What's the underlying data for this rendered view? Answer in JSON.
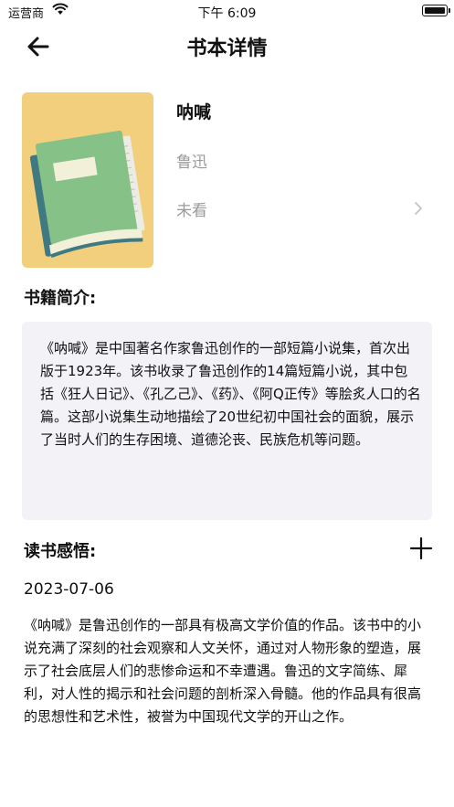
{
  "status_bar": {
    "carrier": "运营商",
    "time": "下午 6:09"
  },
  "nav": {
    "title": "书本详情",
    "back_icon": "arrow-left-icon"
  },
  "book": {
    "title": "呐喊",
    "author": "鲁迅",
    "read_status": "未看",
    "cover_icon": "book-icon"
  },
  "intro": {
    "heading": "书籍简介:",
    "text": "《呐喊》是中国著名作家鲁迅创作的一部短篇小说集，首次出版于1923年。该书收录了鲁迅创作的14篇短篇小说，其中包括《狂人日记》、《孔乙己》、《药》、《阿Q正传》等脍炙人口的名篇。这部小说集生动地描绘了20世纪初中国社会的面貌，展示了当时人们的生存困境、道德沦丧、民族危机等问题。"
  },
  "notes": {
    "heading": "读书感悟:",
    "add_icon": "plus-icon",
    "items": [
      {
        "date": "2023-07-06",
        "text": "《呐喊》是鲁迅创作的一部具有极高文学价值的作品。该书中的小说充满了深刻的社会观察和人文关怀，通过对人物形象的塑造，展示了社会底层人们的悲惨命运和不幸遭遇。鲁迅的文字简练、犀利，对人性的揭示和社会问题的剖析深入骨髓。他的作品具有很高的思想性和艺术性，被誉为中国现代文学的开山之作。"
      }
    ]
  },
  "colors": {
    "cover_bg": "#f2cf7d",
    "book_green": "#86c287",
    "book_spine": "#3f7a82",
    "intro_bg": "#f2f2f7",
    "muted_text": "#9a9a9a"
  }
}
